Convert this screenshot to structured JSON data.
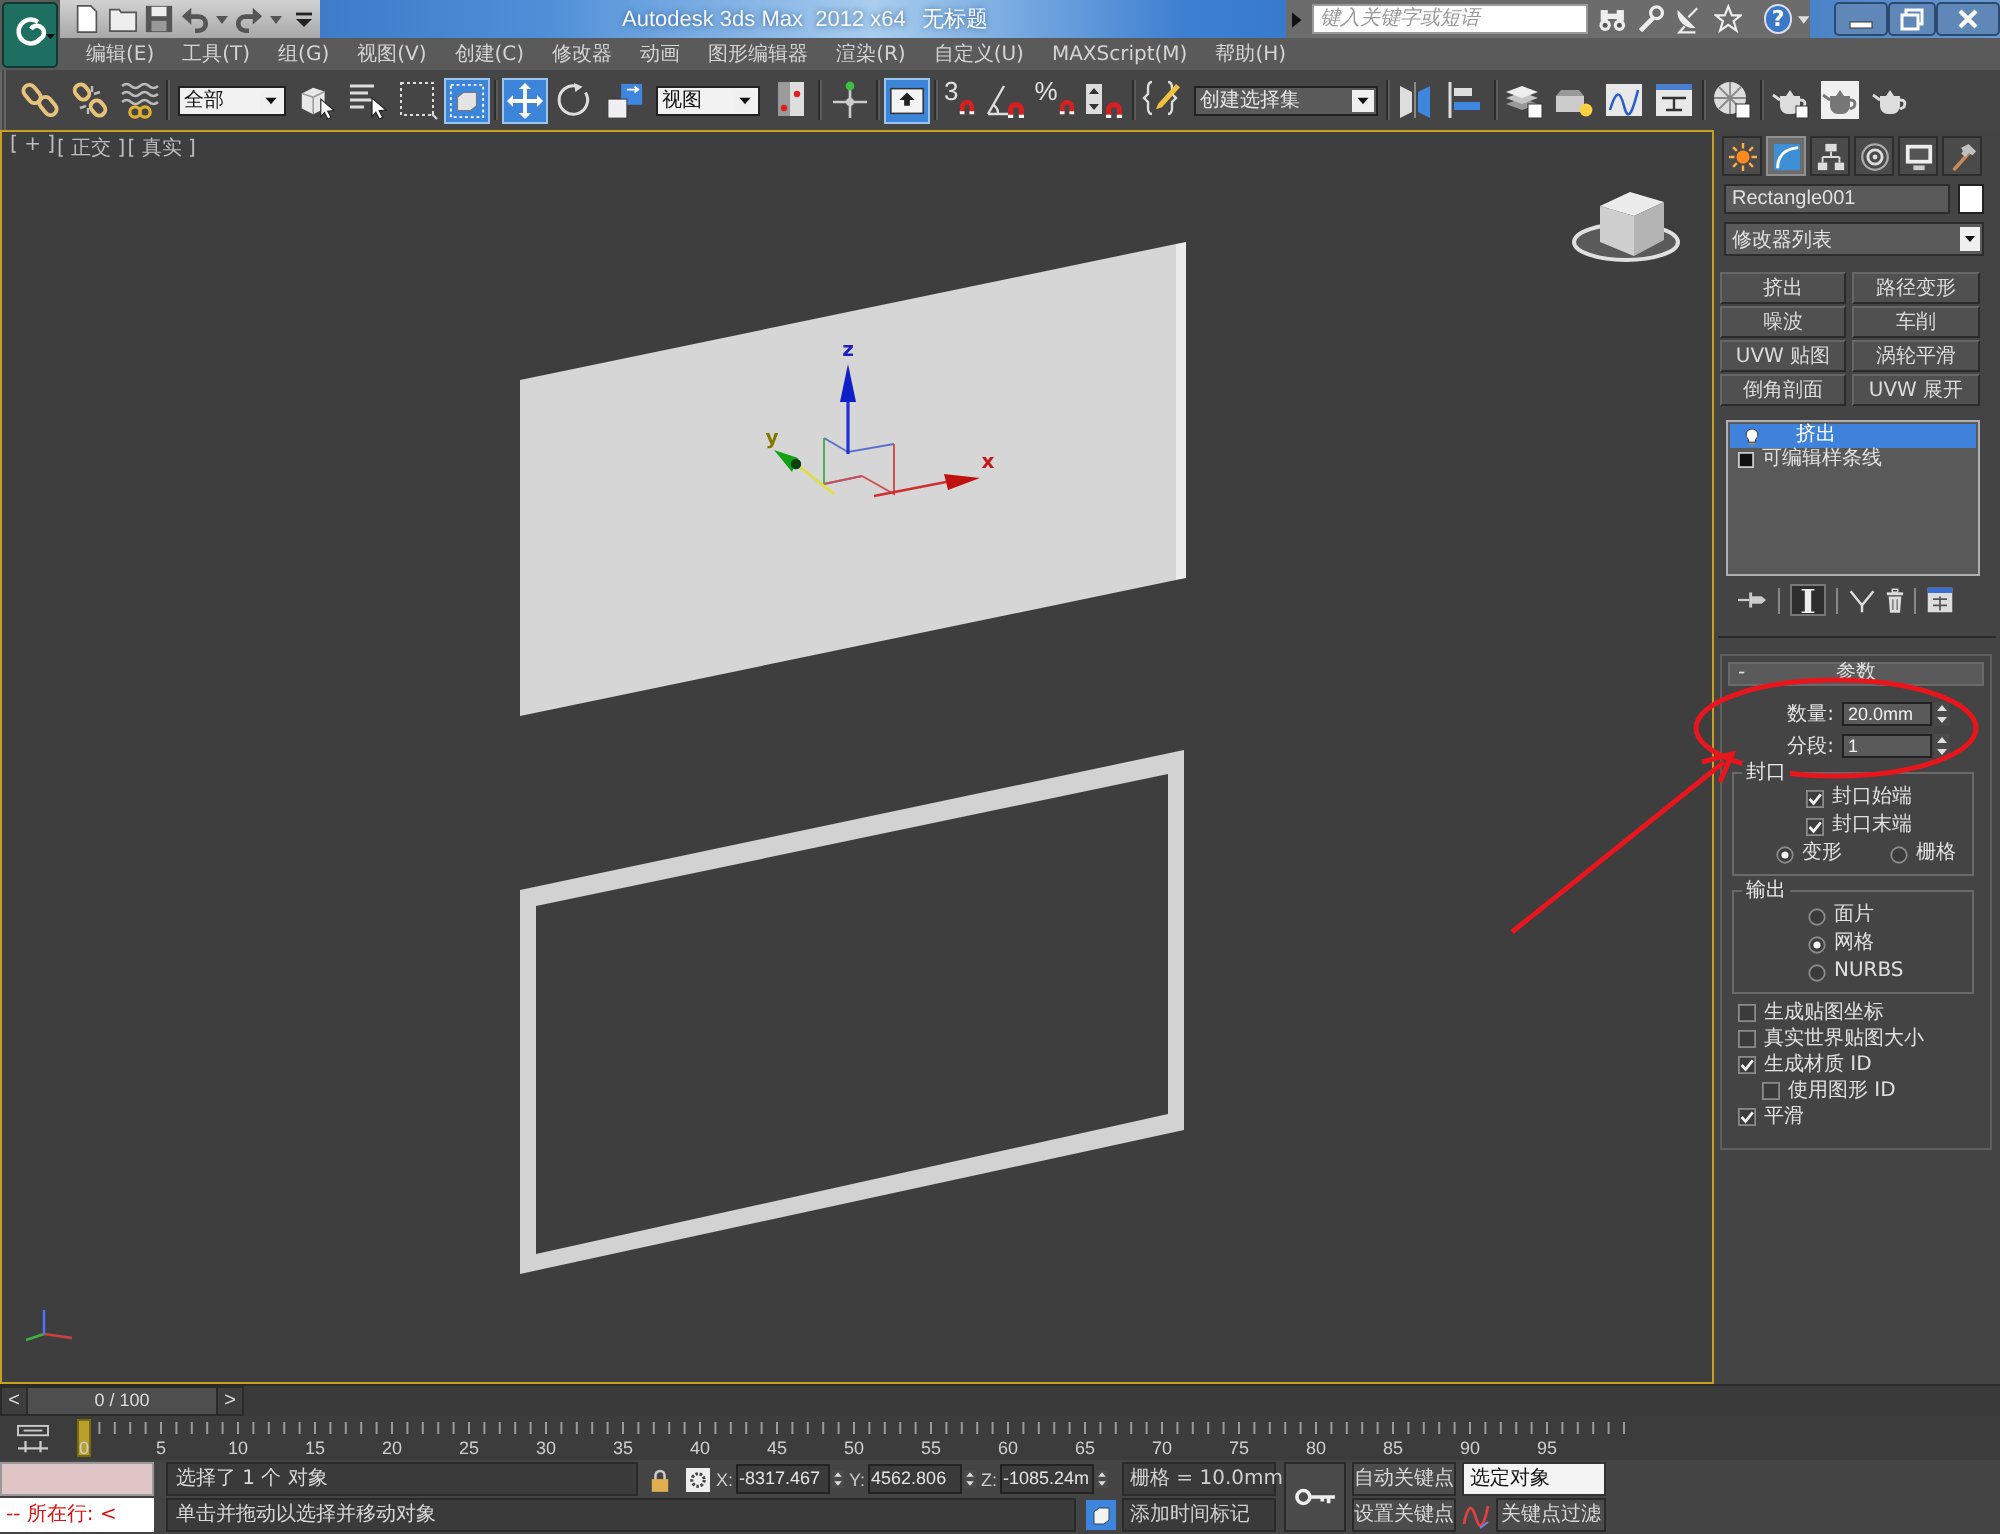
{
  "title_bar": {
    "app_title": "Autodesk 3ds Max  2012 x64",
    "document_title": "无标题",
    "search": {
      "placeholder": "键入关键字或短语"
    },
    "help": "?"
  },
  "menu_bar": [
    "编辑(E)",
    "工具(T)",
    "组(G)",
    "视图(V)",
    "创建(C)",
    "修改器",
    "动画",
    "图形编辑器",
    "渲染(R)",
    "自定义(U)",
    "MAXScript(M)",
    "帮助(H)"
  ],
  "main_toolbar": {
    "selection_filter": "全部",
    "select_object": {
      "selected": false
    },
    "window_crossing": {
      "selected": true
    },
    "select_and_move": {
      "selected": true
    },
    "select_and_rotate": {
      "selected": false
    },
    "select_and_scale": {
      "selected": false
    },
    "reference_coordinate_system": "视图",
    "keyboard_shortcut_override": {
      "selected": true
    },
    "snap_toggle": "3",
    "percent_snap": "%",
    "named_selection_set": "创建选择集"
  },
  "viewport": {
    "active": true,
    "labels": [
      "[ + ]",
      "[ 正交 ]",
      "[ 真实 ]"
    ],
    "gizmo_axes": [
      "x",
      "y",
      "z"
    ]
  },
  "command_panel": {
    "tabs": [
      {
        "selected": false
      },
      {
        "selected": true
      },
      {
        "selected": false
      },
      {
        "selected": false
      },
      {
        "selected": false
      },
      {
        "selected": false
      }
    ],
    "object_name": "Rectangle001",
    "modifier_list": "修改器列表",
    "modifier_buttons": [
      "挤出",
      "路径变形",
      "噪波",
      "车削",
      "UVW 贴图",
      "涡轮平滑",
      "倒角剖面",
      "UVW 展开"
    ],
    "modifier_stack": [
      {
        "kind": "modifier",
        "label": "挤出",
        "selected": true
      },
      {
        "kind": "base_object",
        "label": "可编辑样条线",
        "selected": false
      }
    ],
    "show_end_result": {
      "on": true
    },
    "rollout": {
      "expander": "-",
      "title": "参数"
    },
    "amount": {
      "label": "数量:",
      "value": "20.0mm"
    },
    "segments": {
      "label": "分段:",
      "value": "1"
    },
    "capping": {
      "title": "封口",
      "options": [
        {
          "label": "封口始端",
          "checked": true
        },
        {
          "label": "封口末端",
          "checked": true
        }
      ],
      "type": [
        {
          "label": "变形",
          "selected": true
        },
        {
          "label": "栅格",
          "selected": false
        }
      ]
    },
    "output": {
      "title": "输出",
      "options": [
        {
          "label": "面片",
          "selected": false
        },
        {
          "label": "网格",
          "selected": true
        },
        {
          "label": "NURBS",
          "selected": false
        }
      ]
    },
    "options": [
      {
        "label": "生成贴图坐标",
        "checked": false
      },
      {
        "label": "真实世界贴图大小",
        "checked": false
      },
      {
        "label": "生成材质 ID",
        "checked": true,
        "children": [
          {
            "label": "使用图形 ID",
            "checked": false
          }
        ]
      },
      {
        "label": "平滑",
        "checked": true
      }
    ]
  },
  "time_slider": {
    "prev": "<",
    "position": "0 / 100",
    "next": ">",
    "level": 0
  },
  "track_bar": {
    "frame_labels": [
      "0",
      "5",
      "10",
      "15",
      "20",
      "25",
      "30",
      "35",
      "40",
      "45",
      "50",
      "55",
      "60",
      "65",
      "70",
      "75",
      "80",
      "85",
      "90",
      "95"
    ]
  },
  "status_bar": {
    "listener": "-- 所在行: <",
    "prompt": "选择了 1 个 对象",
    "hint": "单击并拖动以选择并移动对象",
    "coordinates": [
      {
        "axis": "X:",
        "value": "-8317.467"
      },
      {
        "axis": "Y:",
        "value": "4562.806"
      },
      {
        "axis": "Z:",
        "value": "-1085.24m"
      }
    ],
    "grid": "栅格 = 10.0mm",
    "time_tag": "添加时间标记",
    "auto_key": {
      "label": "自动关键点",
      "on": false
    },
    "key_mode": "选定对象",
    "set_key": "设置关键点",
    "key_filters": "关键点过滤"
  }
}
